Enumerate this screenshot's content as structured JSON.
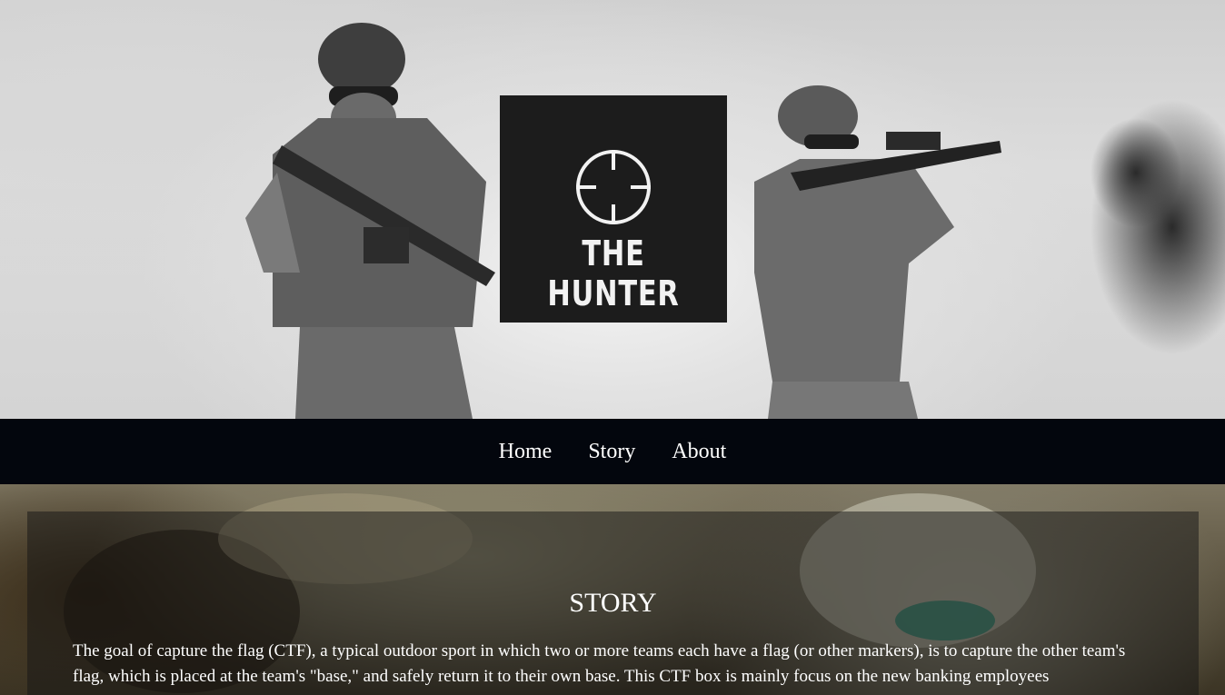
{
  "brand": {
    "logo_text": "THE HUNTER"
  },
  "nav": {
    "items": [
      "Home",
      "Story",
      "About"
    ]
  },
  "story": {
    "title": "STORY",
    "body": "The goal of capture the flag (CTF), a typical outdoor sport in which two or more teams each have a flag (or other markers), is to capture the other team's flag, which is placed at the team's \"base,\" and safely return it to their own base. This CTF box is mainly focus on the new banking employees"
  },
  "colors": {
    "nav_bg": "#03060d",
    "logo_bg": "#1c1c1c",
    "text": "#ffffff"
  }
}
